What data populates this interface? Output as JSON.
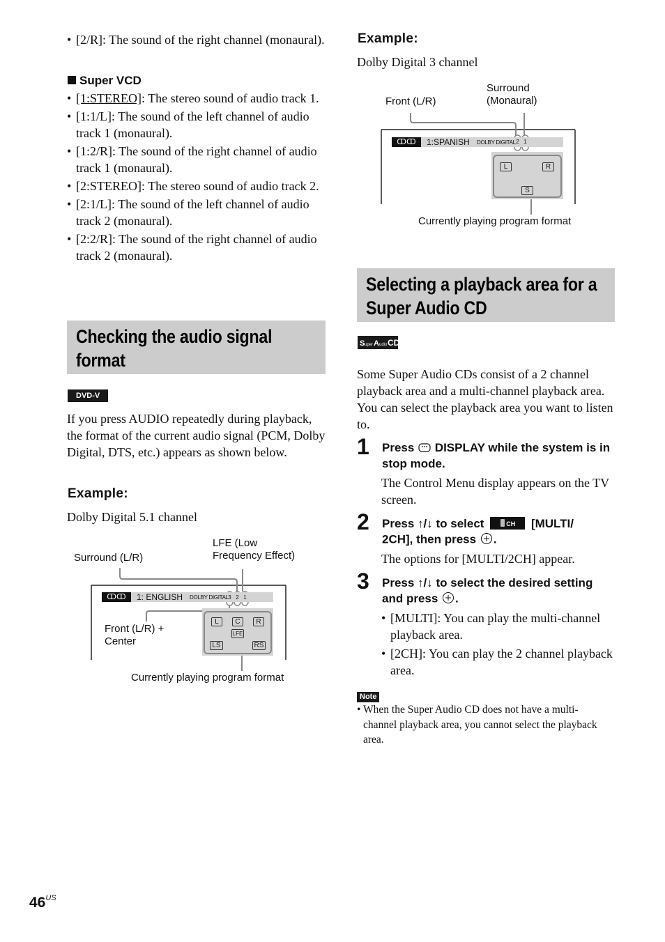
{
  "left_column": {
    "intro_bullets": [
      "[2/R]: The sound of the right channel (monaural)."
    ],
    "super_vcd": {
      "heading": "Super VCD",
      "items": [
        {
          "key": "[1:STEREO]",
          "text": ": The stereo sound of audio track 1.",
          "underlined": true
        },
        {
          "key": "[1:1/L]",
          "text": ": The sound of the left channel of audio track 1 (monaural).",
          "underlined": false
        },
        {
          "key": "[1:2/R]",
          "text": ": The sound of the right channel of audio track 1 (monaural).",
          "underlined": false
        },
        {
          "key": "[2:STEREO]",
          "text": ": The stereo sound of audio track 2.",
          "underlined": false
        },
        {
          "key": "[2:1/L]",
          "text": ": The sound of the left channel of audio track 2 (monaural).",
          "underlined": false
        },
        {
          "key": "[2:2/R]",
          "text": ": The sound of the right channel of audio track 2 (monaural).",
          "underlined": false
        }
      ]
    },
    "section": {
      "heading_line1": "Checking the audio signal",
      "heading_line2": "format",
      "badge": "DVD-V",
      "body": "If you press AUDIO repeatedly during playback, the format of the current audio signal (PCM, Dolby Digital, DTS, etc.) appears as shown below.",
      "example_label": "Example:",
      "example_caption": "Dolby Digital 5.1 channel"
    },
    "diagram": {
      "label_surround": "Surround (L/R)",
      "label_lfe_line1": "LFE (Low",
      "label_lfe_line2": "Frequency Effect)",
      "label_front_line1": "Front (L/R) +",
      "label_front_line2": "Center",
      "label_current": "Currently playing program format",
      "osd_language": "1: ENGLISH",
      "osd_format": "DOLBY DIGITAL",
      "osd_icon": "audio-icon",
      "channel_counts": [
        "3",
        "2",
        "1"
      ],
      "channels": {
        "L": "L",
        "C": "C",
        "R": "R",
        "LFE": "LFE",
        "LS": "LS",
        "RS": "RS"
      }
    }
  },
  "right_column": {
    "example_label": "Example:",
    "example_caption": "Dolby Digital 3 channel",
    "diagram": {
      "label_front": "Front (L/R)",
      "label_surround_line1": "Surround",
      "label_surround_line2": "(Monaural)",
      "label_current": "Currently playing program format",
      "osd_language": "1:SPANISH",
      "osd_format": "DOLBY DIGITAL",
      "osd_icon": "audio-icon",
      "channel_counts": [
        "2",
        "1"
      ],
      "channels": {
        "L": "L",
        "R": "R",
        "S": "S"
      }
    },
    "section": {
      "heading_line1": "Selecting a playback area for a",
      "heading_line2": "Super Audio CD",
      "badge": "Super Audio CD",
      "body": "Some Super Audio CDs consist of a 2 channel playback area and a multi-channel playback area. You can select the playback area you want to listen to."
    },
    "steps": [
      {
        "number": "1",
        "title_pre": "Press",
        "title_icon": "display-button-icon",
        "title_post": "DISPLAY while the system is in stop mode.",
        "body": "The Control Menu display appears on the TV screen."
      },
      {
        "number": "2",
        "title_pre": "Press ↑/↓ to select",
        "title_icon": "multi-2ch-icon",
        "title_icon_text": "CH",
        "title_mid": "[MULTI/",
        "title_line2": "2CH], then press",
        "title_end": ".",
        "body": "The options for [MULTI/2CH] appear."
      },
      {
        "number": "3",
        "title_line1": "Press ↑/↓ to select the desired setting",
        "title_line2": "and press",
        "title_end": ".",
        "bullets": [
          "[MULTI]: You can play the multi-channel playback area.",
          "[2CH]: You can play the 2 channel playback area."
        ]
      }
    ],
    "note": {
      "label": "Note",
      "text": "When the Super Audio CD does not have a multi-channel playback area, you cannot select the playback area."
    }
  },
  "footer": {
    "page_number": "46",
    "page_suffix": "US"
  }
}
